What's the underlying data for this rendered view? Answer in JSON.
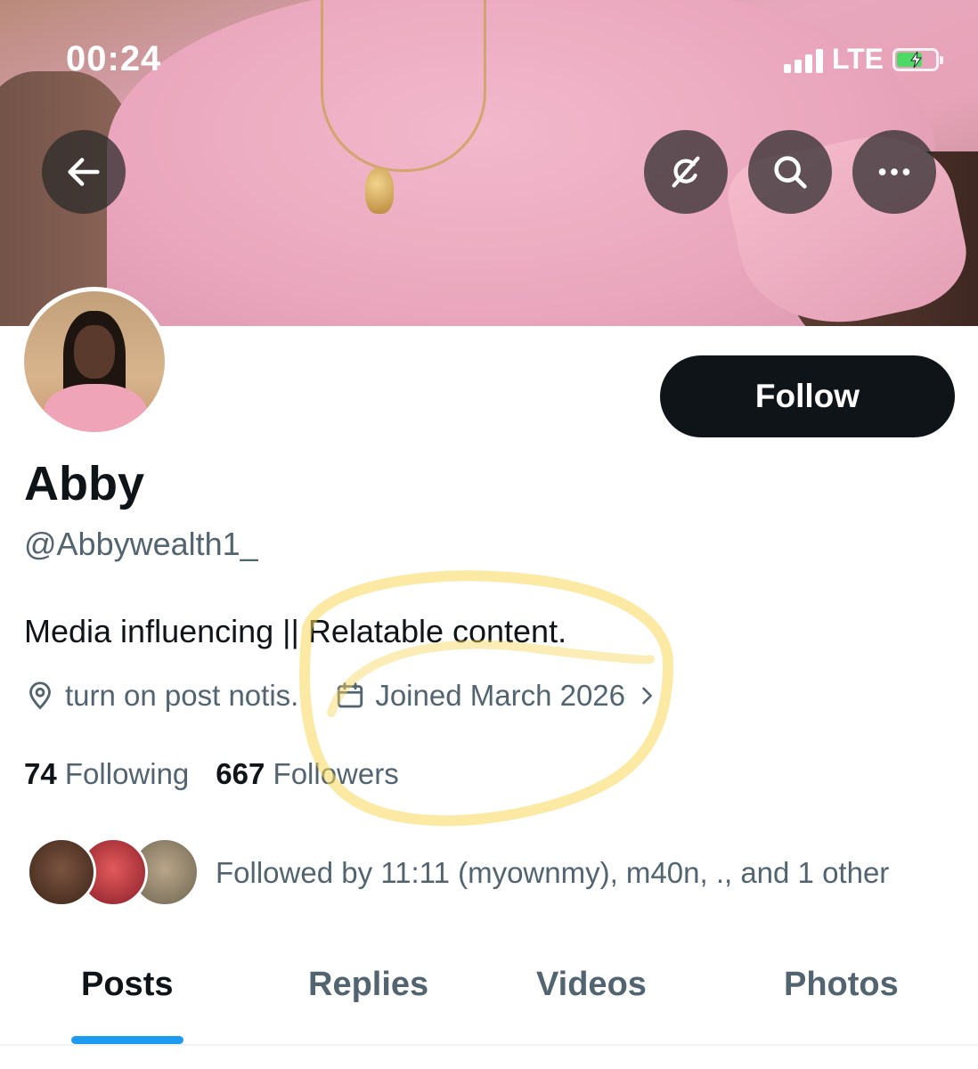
{
  "status_bar": {
    "time": "00:24",
    "network": "LTE",
    "icons": [
      "signal-icon",
      "battery-charging-icon"
    ]
  },
  "header": {
    "buttons": [
      "back-icon",
      "grok-icon",
      "search-icon",
      "more-icon"
    ]
  },
  "profile": {
    "name": "Abby",
    "handle": "@Abbywealth1_",
    "bio": "Media influencing || Relatable content.",
    "location": "turn on post notis.",
    "joined": "Joined March 2026",
    "following_count": "74",
    "following_label": "Following",
    "followers_count": "667",
    "followers_label": "Followers",
    "followed_by": "Followed by 11:11 (myownmy), m40n, ., and 1 other",
    "follow_label": "Follow"
  },
  "tabs": [
    {
      "label": "Posts",
      "active": true
    },
    {
      "label": "Replies",
      "active": false
    },
    {
      "label": "Videos",
      "active": false
    },
    {
      "label": "Photos",
      "active": false
    }
  ],
  "colors": {
    "accent": "#1d9bf0",
    "text_primary": "#0f1419",
    "text_secondary": "#536471",
    "highlight": "#f7d75a"
  }
}
